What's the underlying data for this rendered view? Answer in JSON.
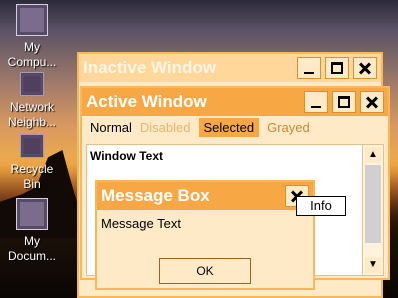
{
  "desktop": {
    "icons": [
      {
        "label_1": "My",
        "label_2": "Compu...",
        "icon": "computer-icon"
      },
      {
        "label_1": "Network",
        "label_2": "Neighb...",
        "icon": "network-icon"
      },
      {
        "label_1": "Recycle",
        "label_2": "Bin",
        "icon": "recycle-bin-icon"
      },
      {
        "label_1": "My",
        "label_2": "Docum...",
        "icon": "documents-icon"
      }
    ]
  },
  "inactive_window": {
    "title": "Inactive Window"
  },
  "active_window": {
    "title": "Active Window",
    "menu": {
      "normal": "Normal",
      "disabled": "Disabled",
      "selected": "Selected",
      "grayed": "Grayed"
    },
    "window_text": "Window Text"
  },
  "message_box": {
    "title": "Message Box",
    "text": "Message Text",
    "ok_label": "OK",
    "tooltip": "Info"
  },
  "colors": {
    "active_title": "#f7a845",
    "inactive_title": "#ffd79a",
    "window_face": "#ffeac8"
  }
}
